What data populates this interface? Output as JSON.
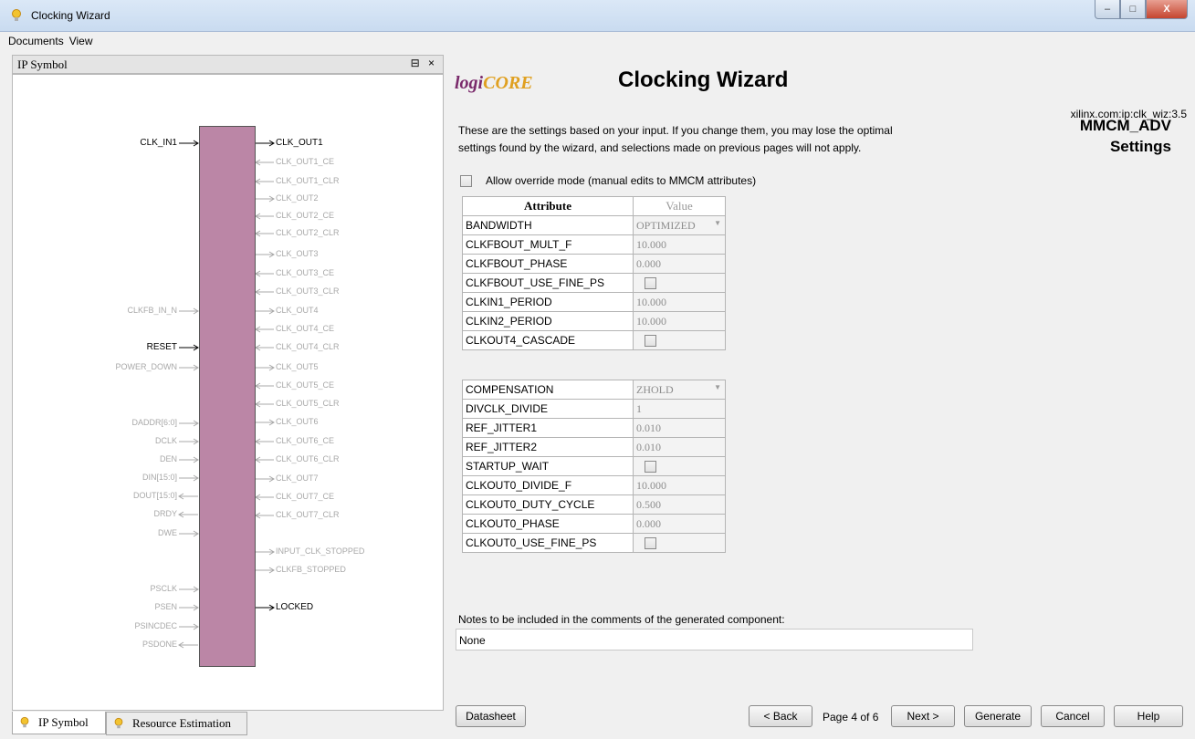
{
  "window": {
    "title": "Clocking Wizard",
    "controls": {
      "minimize": "–",
      "maximize": "□",
      "close": "X"
    }
  },
  "menu": [
    "Documents",
    "View"
  ],
  "left_panel": {
    "header": "IP Symbol",
    "header_controls": "⊟ ×",
    "left_pins": [
      {
        "label": "CLK_IN1",
        "active": true
      },
      {
        "label": "CLKFB_IN_N",
        "active": false
      },
      {
        "label": "RESET",
        "active": true
      },
      {
        "label": "POWER_DOWN",
        "active": false
      },
      {
        "label": "DADDR[6:0]",
        "active": false
      },
      {
        "label": "DCLK",
        "active": false
      },
      {
        "label": "DEN",
        "active": false
      },
      {
        "label": "DIN[15:0]",
        "active": false
      },
      {
        "label": "DOUT[15:0]",
        "active": false
      },
      {
        "label": "DRDY",
        "active": false
      },
      {
        "label": "DWE",
        "active": false
      },
      {
        "label": "PSCLK",
        "active": false
      },
      {
        "label": "PSEN",
        "active": false
      },
      {
        "label": "PSINCDEC",
        "active": false
      },
      {
        "label": "PSDONE",
        "active": false
      }
    ],
    "right_pins": [
      {
        "label": "CLK_OUT1",
        "active": true
      },
      {
        "label": "CLK_OUT1_CE",
        "active": false
      },
      {
        "label": "CLK_OUT1_CLR",
        "active": false
      },
      {
        "label": "CLK_OUT2",
        "active": false
      },
      {
        "label": "CLK_OUT2_CE",
        "active": false
      },
      {
        "label": "CLK_OUT2_CLR",
        "active": false
      },
      {
        "label": "CLK_OUT3",
        "active": false
      },
      {
        "label": "CLK_OUT3_CE",
        "active": false
      },
      {
        "label": "CLK_OUT3_CLR",
        "active": false
      },
      {
        "label": "CLK_OUT4",
        "active": false
      },
      {
        "label": "CLK_OUT4_CE",
        "active": false
      },
      {
        "label": "CLK_OUT4_CLR",
        "active": false
      },
      {
        "label": "CLK_OUT5",
        "active": false
      },
      {
        "label": "CLK_OUT5_CE",
        "active": false
      },
      {
        "label": "CLK_OUT5_CLR",
        "active": false
      },
      {
        "label": "CLK_OUT6",
        "active": false
      },
      {
        "label": "CLK_OUT6_CE",
        "active": false
      },
      {
        "label": "CLK_OUT6_CLR",
        "active": false
      },
      {
        "label": "CLK_OUT7",
        "active": false
      },
      {
        "label": "CLK_OUT7_CE",
        "active": false
      },
      {
        "label": "CLK_OUT7_CLR",
        "active": false
      },
      {
        "label": "INPUT_CLK_STOPPED",
        "active": false
      },
      {
        "label": "CLKFB_STOPPED",
        "active": false
      },
      {
        "label": "LOCKED",
        "active": true
      }
    ],
    "tabs": [
      {
        "label": "IP Symbol",
        "active": true
      },
      {
        "label": "Resource Estimation",
        "active": false
      }
    ]
  },
  "header": {
    "logo_prefix": "logi",
    "logo_suffix": "CORE",
    "title": "Clocking Wizard",
    "ip_version": "xilinx.com:ip:clk_wiz:3.5",
    "section_line1": "MMCM_ADV",
    "section_line2": "Settings"
  },
  "intro_line1": "These are the settings based on your input.  If you change them, you may lose the optimal",
  "intro_line2": "settings found by the wizard, and selections made on previous pages will not apply.",
  "override_label": "Allow override mode (manual edits to MMCM attributes)",
  "table_headers": {
    "attribute": "Attribute",
    "value": "Value"
  },
  "table1": [
    {
      "name": "BANDWIDTH",
      "value": "OPTIMIZED",
      "kind": "select"
    },
    {
      "name": "CLKFBOUT_MULT_F",
      "value": "10.000",
      "kind": "text"
    },
    {
      "name": "CLKFBOUT_PHASE",
      "value": "0.000",
      "kind": "text"
    },
    {
      "name": "CLKFBOUT_USE_FINE_PS",
      "value": "",
      "kind": "check"
    },
    {
      "name": "CLKIN1_PERIOD",
      "value": "10.000",
      "kind": "text"
    },
    {
      "name": "CLKIN2_PERIOD",
      "value": "10.000",
      "kind": "text"
    },
    {
      "name": "CLKOUT4_CASCADE",
      "value": "",
      "kind": "check"
    }
  ],
  "table2": [
    {
      "name": "COMPENSATION",
      "value": "ZHOLD",
      "kind": "select"
    },
    {
      "name": "DIVCLK_DIVIDE",
      "value": "1",
      "kind": "text"
    },
    {
      "name": "REF_JITTER1",
      "value": "0.010",
      "kind": "text"
    },
    {
      "name": "REF_JITTER2",
      "value": "0.010",
      "kind": "text"
    },
    {
      "name": "STARTUP_WAIT",
      "value": "",
      "kind": "check"
    },
    {
      "name": "CLKOUT0_DIVIDE_F",
      "value": "10.000",
      "kind": "text"
    },
    {
      "name": "CLKOUT0_DUTY_CYCLE",
      "value": "0.500",
      "kind": "text"
    },
    {
      "name": "CLKOUT0_PHASE",
      "value": "0.000",
      "kind": "text"
    },
    {
      "name": "CLKOUT0_USE_FINE_PS",
      "value": "",
      "kind": "check"
    }
  ],
  "notes": {
    "label": "Notes to be included in the comments of the generated component:",
    "value": "None"
  },
  "footer": {
    "datasheet": "Datasheet",
    "back": "< Back",
    "page_info": "Page 4 of 6",
    "next": "Next >",
    "generate": "Generate",
    "cancel": "Cancel",
    "help": "Help"
  }
}
